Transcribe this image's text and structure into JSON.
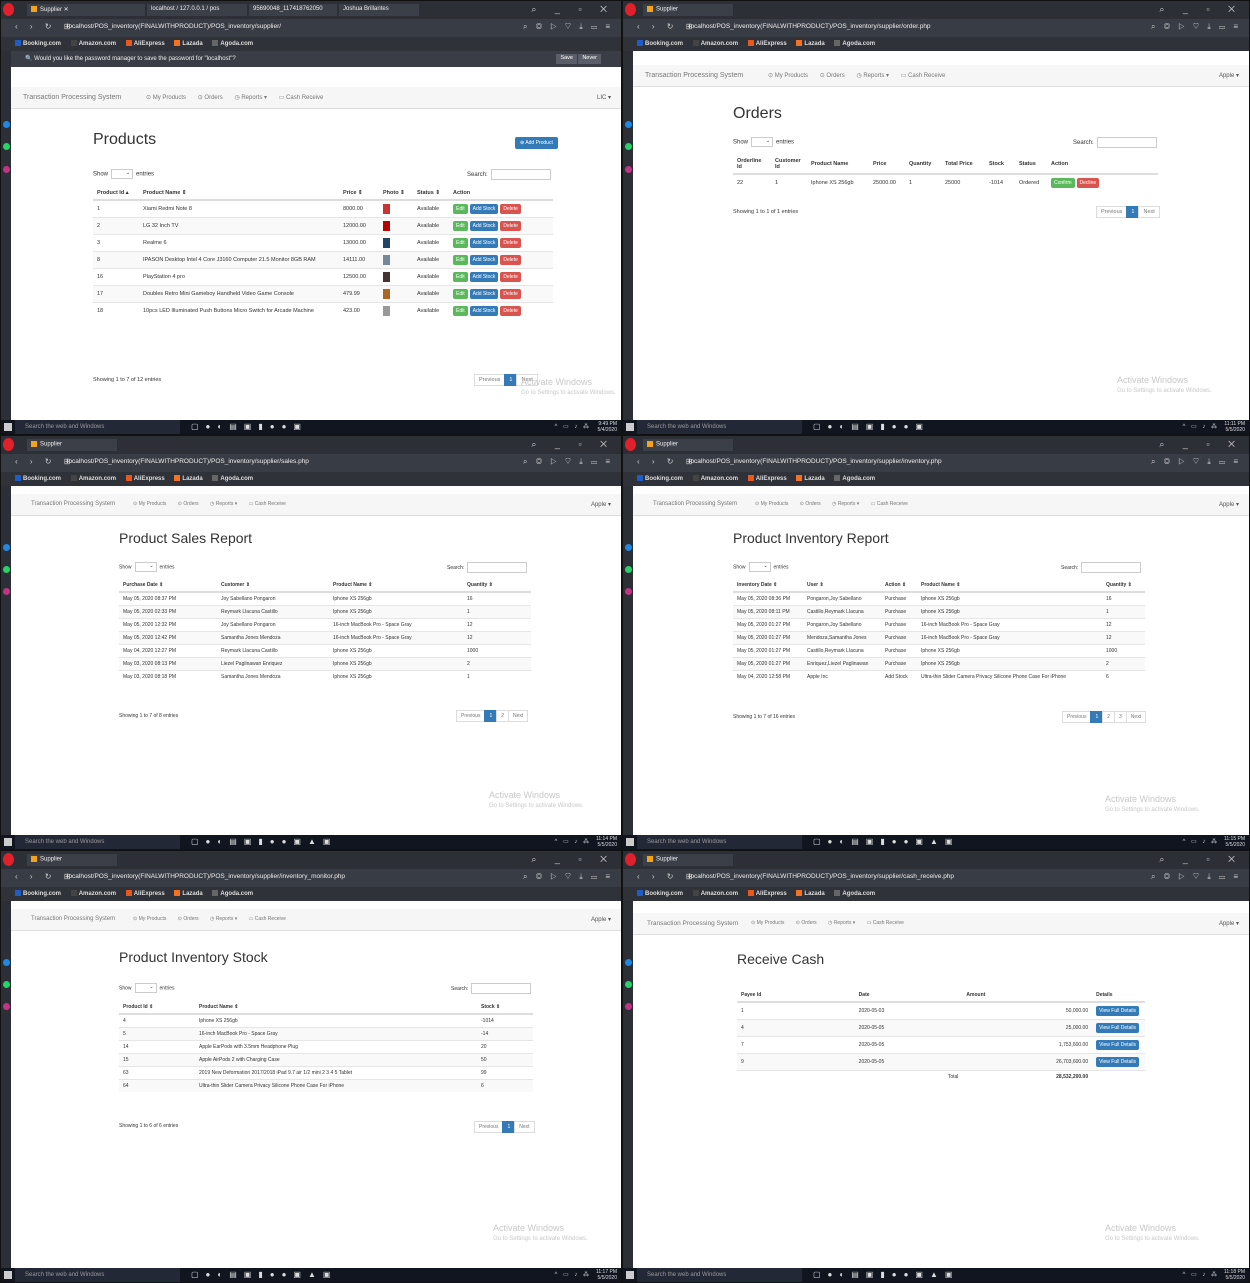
{
  "colors": {
    "accent": "#337ab7",
    "edit": "#5cb85c",
    "delete": "#d9534f",
    "browser_dark": "#2c2f36",
    "taskbar": "#101520"
  },
  "common": {
    "app_title": "Transaction Processing System",
    "nav": [
      "My Products",
      "Orders",
      "Reports ▾",
      "Cash Receive"
    ],
    "bookmarks": [
      "Booking.com",
      "Amazon.com",
      "AliExpress",
      "Lazada",
      "Agoda.com"
    ],
    "taskbar_search": "Search the web and Windows",
    "watermark_title": "Activate Windows",
    "watermark_sub": "Go to Settings to activate Windows.",
    "show": "Show",
    "entries": "entries",
    "search": "Search:",
    "previous": "Previous",
    "next": "Next",
    "tab_supplier": "Supplier"
  },
  "s1": {
    "tabs": [
      "Supplier",
      "localhost / 127.0.0.1 / pos",
      "95690048_117418762050",
      "Joshua Brillantes"
    ],
    "url": "localhost/POS_inventory(FINALWITHPRODUCT)/POS_inventory/supplier/",
    "pw_prompt": "Would you like the password manager to save the password for \"localhost\"?",
    "pw_save": "Save",
    "pw_never": "Never",
    "user": "LIC ▾",
    "title": "Products",
    "add_btn": "Add Product",
    "headers": [
      "Product Id",
      "Product Name",
      "Price",
      "Photo",
      "Status",
      "Action"
    ],
    "rows": [
      [
        "1",
        "Xiami Redmi Note 8",
        "8000.00",
        "Available"
      ],
      [
        "2",
        "LG 32 Inch TV",
        "12000.00",
        "Available"
      ],
      [
        "3",
        "Realme 6",
        "13000.00",
        "Available"
      ],
      [
        "8",
        "IPASON Desktop Intel 4 Core J3160 Computer 21.5 Monitor 8GB RAM",
        "14111.00",
        "Available"
      ],
      [
        "16",
        "PlayStation 4 pro",
        "12500.00",
        "Available"
      ],
      [
        "17",
        "Doubles Retro Mini Gameboy Handheld Video Game Console",
        "479.99",
        "Available"
      ],
      [
        "18",
        "10pcs LED Illuminated Push Buttons Micro Switch for Arcade Machine",
        "423.00",
        "Available"
      ]
    ],
    "actions": [
      "Edit",
      "Add Stock",
      "Delete"
    ],
    "info": "Showing 1 to 7 of 12 entries",
    "clock": [
      "9:49 PM",
      "5/4/2020"
    ]
  },
  "s2": {
    "url": "localhost/POS_inventory(FINALWITHPRODUCT)/POS_inventory/supplier/order.php",
    "user": "Apple ▾",
    "title": "Orders",
    "headers": [
      "Orderline Id",
      "Customer Id",
      "Product Name",
      "Price",
      "Quantity",
      "Total Price",
      "Stock",
      "Status",
      "Action"
    ],
    "rows": [
      [
        "22",
        "1",
        "Iphone XS 256gb",
        "25000.00",
        "1",
        "25000",
        "-1014",
        "Ordered"
      ]
    ],
    "actions": [
      "Confirm",
      "Decline"
    ],
    "info": "Showing 1 to 1 of 1 entries",
    "clock": [
      "11:11 PM",
      "5/5/2020"
    ]
  },
  "s3": {
    "url": "localhost/POS_inventory(FINALWITHPRODUCT)/POS_inventory/supplier/sales.php",
    "user": "Apple ▾",
    "title": "Product Sales Report",
    "headers": [
      "Purchase Date",
      "Customer",
      "Product Name",
      "Quantity"
    ],
    "rows": [
      [
        "May 05, 2020 08:37 PM",
        "Joy Sabellano Pongaron",
        "Iphone XS 256gb",
        "16"
      ],
      [
        "May 05, 2020 02:33 PM",
        "Reymark Llacuna Castillo",
        "Iphone XS 256gb",
        "1"
      ],
      [
        "May 05, 2020 12:32 PM",
        "Joy Sabellano Pongaron",
        "16-inch MacBook Pro - Space Gray",
        "12"
      ],
      [
        "May 05, 2020 12:42 PM",
        "Samantha Jones Mendoza",
        "16-inch MacBook Pro - Space Gray",
        "12"
      ],
      [
        "May 04, 2020 12:27 PM",
        "Reymark Llacuna Castillo",
        "Iphone XS 256gb",
        "1000"
      ],
      [
        "May 03, 2020 08:13 PM",
        "Liezel Paglinawan Enriquez",
        "Iphone XS 256gb",
        "2"
      ],
      [
        "May 03, 2020 08:18 PM",
        "Samantha Jones Mendoza",
        "Iphone XS 256gb",
        "1"
      ]
    ],
    "info": "Showing 1 to 7 of 8 entries",
    "pages": [
      "1",
      "2"
    ],
    "clock": [
      "11:14 PM",
      "5/5/2020"
    ]
  },
  "s4": {
    "url": "localhost/POS_inventory(FINALWITHPRODUCT)/POS_inventory/supplier/inventory.php",
    "user": "Apple ▾",
    "title": "Product Inventory Report",
    "headers": [
      "Inventory Date",
      "User",
      "Action",
      "Product Name",
      "Quantity"
    ],
    "rows": [
      [
        "May 05, 2020 08:36 PM",
        "Pongaron,Joy Sabellano",
        "Purchase",
        "Iphone XS 256gb",
        "16"
      ],
      [
        "May 05, 2020 08:11 PM",
        "Castillo,Reymark Llacuna",
        "Purchase",
        "Iphone XS 256gb",
        "1"
      ],
      [
        "May 05, 2020 01:27 PM",
        "Pongaron,Joy Sabellano",
        "Purchase",
        "16-inch MacBook Pro - Space Gray",
        "12"
      ],
      [
        "May 05, 2020 01:27 PM",
        "Mendoza,Samantha Jones",
        "Purchase",
        "16-inch MacBook Pro - Space Gray",
        "12"
      ],
      [
        "May 05, 2020 01:27 PM",
        "Castillo,Reymark Llacuna",
        "Purchase",
        "Iphone XS 256gb",
        "1000"
      ],
      [
        "May 05, 2020 01:27 PM",
        "Enriquez,Liezel Paglinawan",
        "Purchase",
        "Iphone XS 256gb",
        "2"
      ],
      [
        "May 04, 2020 12:58 PM",
        "Apple Inc",
        "Add Stock",
        "Ultra-thin Slider Camera Privacy Silicone Phone Case For iPhone",
        "6"
      ]
    ],
    "info": "Showing 1 to 7 of 16 entries",
    "pages": [
      "1",
      "2",
      "3"
    ],
    "clock": [
      "11:15 PM",
      "5/5/2020"
    ]
  },
  "s5": {
    "url": "localhost/POS_inventory(FINALWITHPRODUCT)/POS_inventory/supplier/inventory_monitor.php",
    "user": "Apple ▾",
    "title": "Product Inventory Stock",
    "headers": [
      "Product Id",
      "Product Name",
      "Stock"
    ],
    "rows": [
      [
        "4",
        "Iphone XS 256gb",
        "-1014"
      ],
      [
        "5",
        "16-inch MacBook Pro - Space Gray",
        "-14"
      ],
      [
        "14",
        "Apple EarPods with 3.5mm Headphone Plug",
        "20"
      ],
      [
        "15",
        "Apple AirPods 2 with Charging Case",
        "50"
      ],
      [
        "63",
        "2019 New Deformation 2017/2018 iPad 9.7 air 1/2 mini 2 3 4 5 Tablet",
        "99"
      ],
      [
        "64",
        "Ultra-thin Slider Camera Privacy Silicone Phone Case For iPhone",
        "6"
      ]
    ],
    "info": "Showing 1 to 6 of 6 entries",
    "pages": [
      "1"
    ],
    "clock": [
      "11:17 PM",
      "5/5/2020"
    ]
  },
  "s6": {
    "url": "localhost/POS_inventory(FINALWITHPRODUCT)/POS_inventory/supplier/cash_receive.php",
    "user": "Apple ▾",
    "title": "Receive Cash",
    "headers": [
      "Payee Id",
      "Date",
      "Amount",
      "Details"
    ],
    "rows": [
      [
        "1",
        "2020-05-03",
        "50,000.00"
      ],
      [
        "4",
        "2020-05-05",
        "25,000.00"
      ],
      [
        "7",
        "2020-05-05",
        "1,753,600.00"
      ],
      [
        "9",
        "2020-05-05",
        "26,703,600.00"
      ]
    ],
    "details_btn": "View Full Details",
    "total_label": "Total",
    "total": "28,532,200.00",
    "clock": [
      "11:18 PM",
      "5/5/2020"
    ]
  }
}
